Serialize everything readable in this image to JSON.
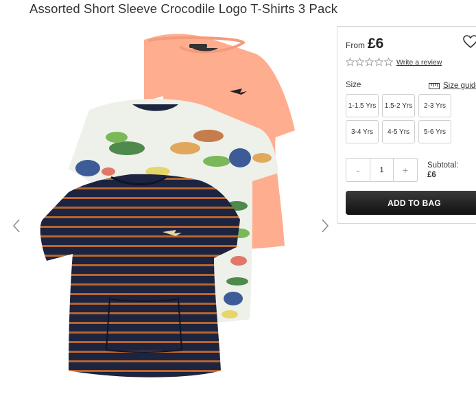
{
  "product": {
    "title": "Assorted Short Sleeve Crocodile Logo T-Shirts 3 Pack"
  },
  "panel": {
    "from_label": "From",
    "price": "£6",
    "rating_stars": 0,
    "write_review": "Write a review",
    "size_label": "Size",
    "size_guide": "Size guide",
    "sizes": [
      "1-1.5 Yrs",
      "1.5-2 Yrs",
      "2-3 Yrs",
      "3-4 Yrs",
      "4-5 Yrs",
      "5-6 Yrs"
    ],
    "qty_minus": "-",
    "qty_value": "1",
    "qty_plus": "+",
    "subtotal_label": "Subtotal:",
    "subtotal_value": "£6",
    "add_to_bag": "ADD TO BAG"
  },
  "colors": {
    "coral": "#ffad8f",
    "navy": "#1d2440",
    "rust": "#b9652c",
    "dino_white": "#eef0ea"
  },
  "icons": [
    "chevron-left-icon",
    "chevron-right-icon",
    "heart-icon",
    "star-icon",
    "ruler-icon"
  ]
}
